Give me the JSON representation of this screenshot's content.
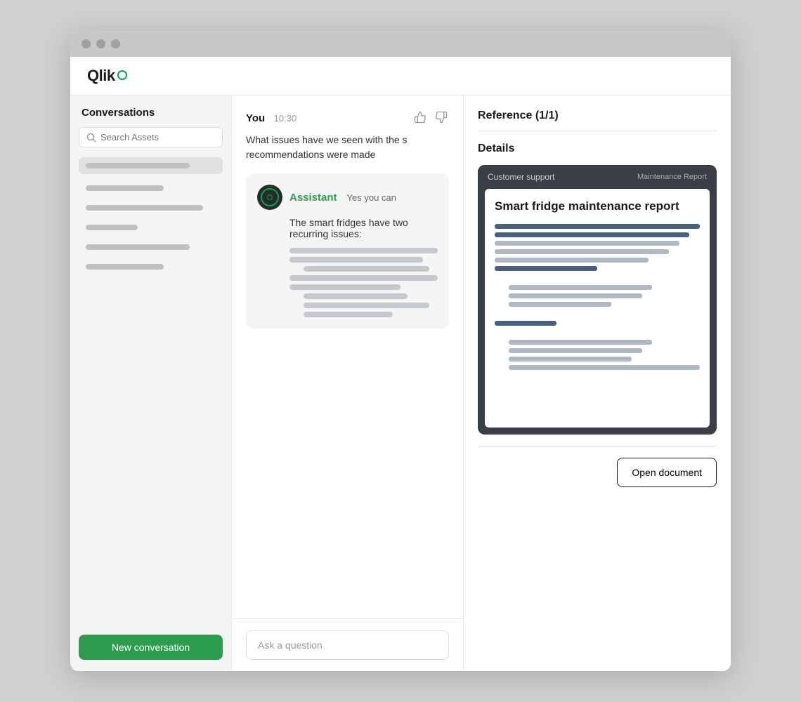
{
  "browser": {
    "dots": [
      "dot1",
      "dot2",
      "dot3"
    ]
  },
  "header": {
    "logo_text": "Qlik"
  },
  "sidebar": {
    "title": "Conversations",
    "search_placeholder": "Search Assets",
    "new_conversation_label": "New conversation"
  },
  "chat": {
    "user_name": "You",
    "user_time": "10:30",
    "user_message": "What issues have we seen with the s recommendations were made",
    "thumbup_label": "👍",
    "thumbdown_label": "👎",
    "assistant_name": "Assistant",
    "assistant_status": "Yes you can",
    "assistant_message": "The smart fridges have two recurring issues:",
    "input_placeholder": "Ask a question"
  },
  "reference_panel": {
    "reference_title": "Reference (1/1)",
    "details_title": "Details",
    "doc_tag": "Customer support",
    "doc_type": "Maintenance Report",
    "doc_title": "Smart fridge maintenance report",
    "open_document_label": "Open document"
  }
}
